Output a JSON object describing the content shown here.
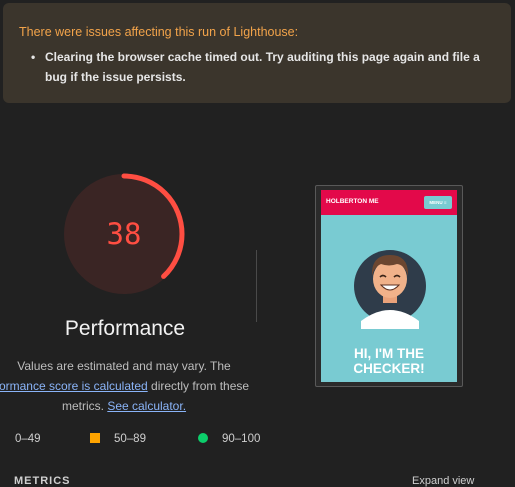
{
  "warning": {
    "title": "There were issues affecting this run of Lighthouse:",
    "items": [
      "Clearing the browser cache timed out. Try auditing this page again and file a bug if the issue persists."
    ]
  },
  "gauge": {
    "score": "38",
    "fraction": 0.38,
    "label": "Performance",
    "color": "#ff4e42"
  },
  "description": {
    "line1": "Values are estimated and may vary. The",
    "link1": "erformance score is calculated",
    "line2_rest": " directly from these",
    "line3_prefix": "metrics. ",
    "link2": "See calculator."
  },
  "legend": {
    "fail": "0–49",
    "average": "50–89",
    "pass": "90–100",
    "average_color": "#ffa400",
    "pass_color": "#0cce6b"
  },
  "screenshot": {
    "logo": "HOLBERTON ME",
    "menu": "MENU ≡",
    "heading_line1": "HI, I'M THE",
    "heading_line2": "CHECKER!"
  },
  "metrics": {
    "header": "METRICS",
    "expand": "Expand view"
  }
}
